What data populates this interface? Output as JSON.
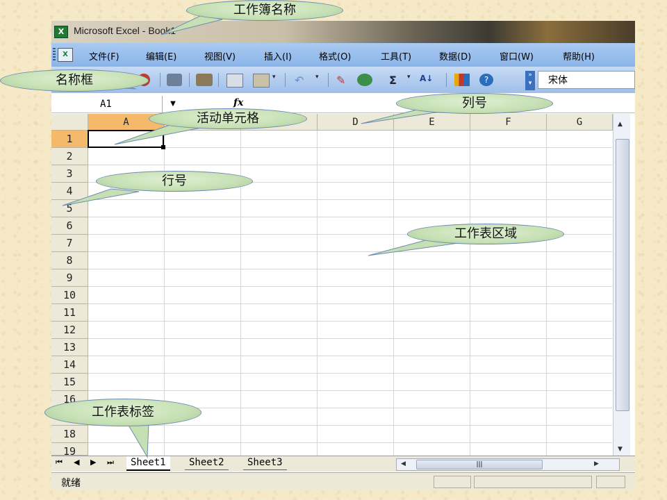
{
  "window": {
    "title": "Microsoft Excel - Book1",
    "icon": "excel-icon"
  },
  "menu": [
    "文件(F)",
    "编辑(E)",
    "视图(V)",
    "插入(I)",
    "格式(O)",
    "工具(T)",
    "数据(D)",
    "窗口(W)",
    "帮助(H)"
  ],
  "toolbar": {
    "font_name": "宋体",
    "sum_symbol": "Σ"
  },
  "formula_bar": {
    "name_box": "A1",
    "fx_label": "fx"
  },
  "columns": [
    "A",
    "B",
    "C",
    "D",
    "E",
    "F",
    "G"
  ],
  "rows": [
    "1",
    "2",
    "3",
    "4",
    "5",
    "6",
    "7",
    "8",
    "9",
    "10",
    "11",
    "12",
    "13",
    "14",
    "15",
    "16",
    "17",
    "18",
    "19"
  ],
  "active_cell": "A1",
  "sheets": [
    "Sheet1",
    "Sheet2",
    "Sheet3"
  ],
  "active_sheet": "Sheet1",
  "status": "就绪",
  "callouts": {
    "workbook_name": "工作簿名称",
    "name_box": "名称框",
    "column_label": "列号",
    "active_cell": "活动单元格",
    "row_label": "行号",
    "sheet_area": "工作表区域",
    "sheet_tab": "工作表标签"
  },
  "colors": {
    "header_active": "#f4b96a",
    "callout_fill": "#c6e0b4",
    "background": "#f5e9c8"
  }
}
